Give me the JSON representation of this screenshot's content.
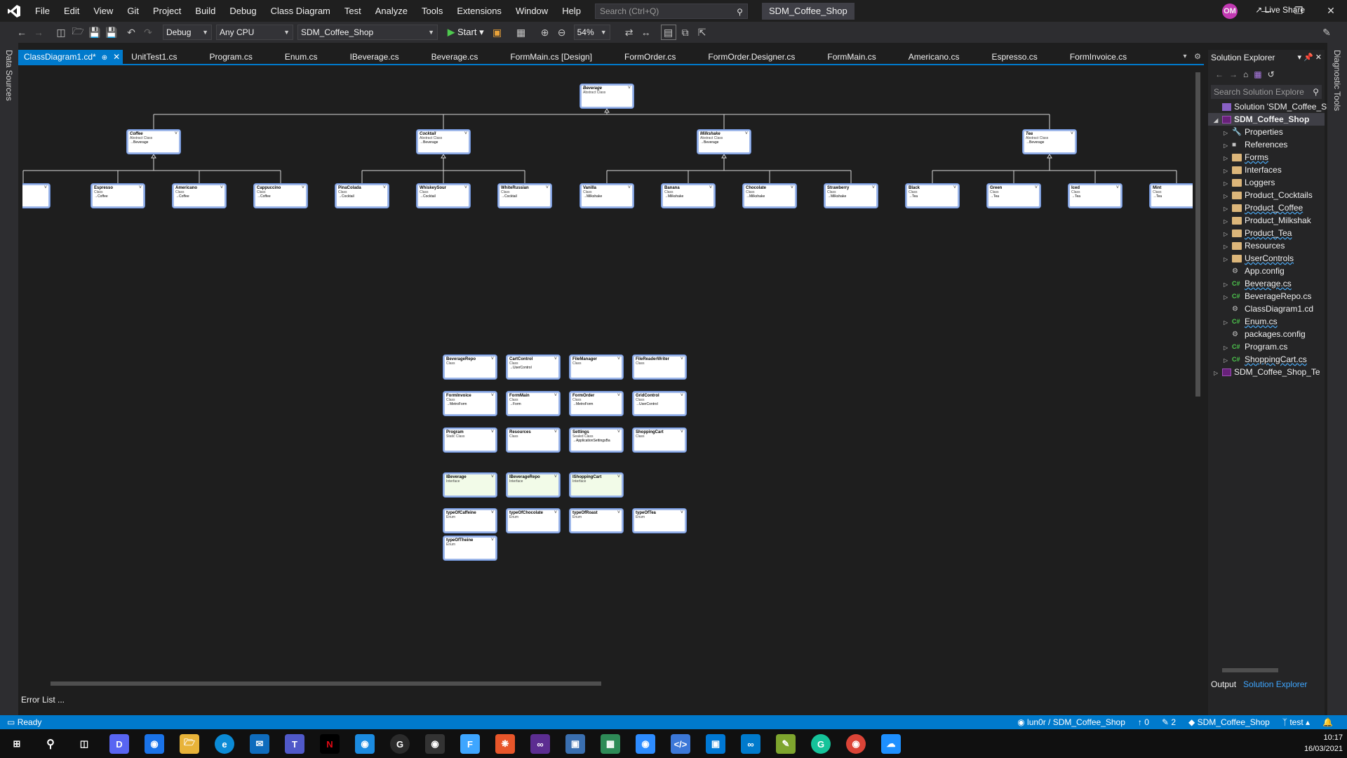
{
  "menubar": {
    "items": [
      "File",
      "Edit",
      "View",
      "Git",
      "Project",
      "Build",
      "Debug",
      "Class Diagram",
      "Test",
      "Analyze",
      "Tools",
      "Extensions",
      "Window",
      "Help"
    ],
    "search_placeholder": "Search (Ctrl+Q)",
    "title": "SDM_Coffee_Shop",
    "avatar": "OM"
  },
  "toolbar": {
    "config": "Debug",
    "platform": "Any CPU",
    "project": "SDM_Coffee_Shop",
    "start": "Start",
    "zoom": "54%",
    "liveshare": "Live Share"
  },
  "left_strip": "Data Sources",
  "right_strip": "Diagnostic Tools",
  "tabs": [
    "ClassDiagram1.cd*",
    "UnitTest1.cs",
    "Program.cs",
    "Enum.cs",
    "IBeverage.cs",
    "Beverage.cs",
    "FormMain.cs [Design]",
    "FormOrder.cs",
    "FormOrder.Designer.cs",
    "FormMain.cs",
    "Americano.cs",
    "Espresso.cs",
    "FormInvoice.cs"
  ],
  "diagram": {
    "root": {
      "name": "Beverage",
      "kind": "Abstract Class"
    },
    "abstracts": [
      {
        "name": "Coffee",
        "kind": "Abstract Class",
        "base": "Beverage"
      },
      {
        "name": "Cocktail",
        "kind": "Abstract Class",
        "base": "Beverage"
      },
      {
        "name": "Milkshake",
        "kind": "Abstract Class",
        "base": "Beverage"
      },
      {
        "name": "Tea",
        "kind": "Abstract Class",
        "base": "Beverage"
      }
    ],
    "leaves": [
      {
        "name": "",
        "kind": "",
        "base": "fee"
      },
      {
        "name": "Espresso",
        "kind": "Class",
        "base": "Coffee"
      },
      {
        "name": "Americano",
        "kind": "Class",
        "base": "Coffee"
      },
      {
        "name": "Cappuccino",
        "kind": "Class",
        "base": "Coffee"
      },
      {
        "name": "PinaColada",
        "kind": "Class",
        "base": "Cocktail"
      },
      {
        "name": "WhiskeySour",
        "kind": "Class",
        "base": "Cocktail"
      },
      {
        "name": "WhiteRussian",
        "kind": "Class",
        "base": "Cocktail"
      },
      {
        "name": "Vanilla",
        "kind": "Class",
        "base": "Milkshake"
      },
      {
        "name": "Banana",
        "kind": "Class",
        "base": "Milkshake"
      },
      {
        "name": "Chocolate",
        "kind": "Class",
        "base": "Milkshake"
      },
      {
        "name": "Strawberry",
        "kind": "Class",
        "base": "Milkshake"
      },
      {
        "name": "Black",
        "kind": "Class",
        "base": "Tea"
      },
      {
        "name": "Green",
        "kind": "Class",
        "base": "Tea"
      },
      {
        "name": "Iced",
        "kind": "Class",
        "base": "Tea"
      },
      {
        "name": "Mint",
        "kind": "Class",
        "base": "Tea"
      }
    ],
    "grid": [
      {
        "name": "BeverageRepo",
        "kind": "Class",
        "base": ""
      },
      {
        "name": "CartControl",
        "kind": "Class",
        "base": "UserControl"
      },
      {
        "name": "FileManager",
        "kind": "Class",
        "base": ""
      },
      {
        "name": "FileReaderWriter",
        "kind": "Class",
        "base": ""
      },
      {
        "name": "FormInvoice",
        "kind": "Class",
        "base": "MetroForm"
      },
      {
        "name": "FormMain",
        "kind": "Class",
        "base": "Form"
      },
      {
        "name": "FormOrder",
        "kind": "Class",
        "base": "MetroForm"
      },
      {
        "name": "GridControl",
        "kind": "Class",
        "base": "UserControl"
      },
      {
        "name": "Program",
        "kind": "Static Class",
        "base": ""
      },
      {
        "name": "Resources",
        "kind": "Class",
        "base": ""
      },
      {
        "name": "Settings",
        "kind": "Sealed Class",
        "base": "ApplicationSettingsBa"
      },
      {
        "name": "ShoppingCart",
        "kind": "Class",
        "base": ""
      }
    ],
    "interfaces": [
      {
        "name": "IBeverage",
        "kind": "Interface"
      },
      {
        "name": "IBeverageRepo",
        "kind": "Interface"
      },
      {
        "name": "IShoppingCart",
        "kind": "Interface"
      }
    ],
    "enums": [
      {
        "name": "typeOfCaffeine",
        "kind": "Enum"
      },
      {
        "name": "typeOfChocolate",
        "kind": "Enum"
      },
      {
        "name": "typeOfRoast",
        "kind": "Enum"
      },
      {
        "name": "typeOfTea",
        "kind": "Enum"
      },
      {
        "name": "typeOfTheine",
        "kind": "Enum"
      }
    ]
  },
  "error_list": "Error List ...",
  "solution_explorer": {
    "title": "Solution Explorer",
    "search_placeholder": "Search Solution Explore",
    "items": [
      {
        "label": "Solution 'SDM_Coffee_Sh",
        "icon": "sln",
        "exp": "",
        "depth": 0
      },
      {
        "label": "SDM_Coffee_Shop",
        "icon": "proj",
        "exp": "down",
        "depth": 0,
        "bold": true
      },
      {
        "label": "Properties",
        "icon": "wrench",
        "exp": "right",
        "depth": 1
      },
      {
        "label": "References",
        "icon": "ref",
        "exp": "right",
        "depth": 1
      },
      {
        "label": "Forms",
        "icon": "folder",
        "exp": "right",
        "depth": 1,
        "squiggle": true
      },
      {
        "label": "Interfaces",
        "icon": "folder",
        "exp": "right",
        "depth": 1
      },
      {
        "label": "Loggers",
        "icon": "folder",
        "exp": "right",
        "depth": 1
      },
      {
        "label": "Product_Cocktails",
        "icon": "folder",
        "exp": "right",
        "depth": 1
      },
      {
        "label": "Product_Coffee",
        "icon": "folder",
        "exp": "right",
        "depth": 1,
        "squiggle": true
      },
      {
        "label": "Product_Milkshak",
        "icon": "folder",
        "exp": "right",
        "depth": 1
      },
      {
        "label": "Product_Tea",
        "icon": "folder",
        "exp": "right",
        "depth": 1,
        "squiggle": true
      },
      {
        "label": "Resources",
        "icon": "folder",
        "exp": "right",
        "depth": 1
      },
      {
        "label": "UserControls",
        "icon": "folder",
        "exp": "right",
        "depth": 1,
        "squiggle": true
      },
      {
        "label": "App.config",
        "icon": "cfg",
        "exp": "",
        "depth": 1
      },
      {
        "label": "Beverage.cs",
        "icon": "cs",
        "exp": "right",
        "depth": 1,
        "squiggle": true
      },
      {
        "label": "BeverageRepo.cs",
        "icon": "cs",
        "exp": "right",
        "depth": 1
      },
      {
        "label": "ClassDiagram1.cd",
        "icon": "cfg",
        "exp": "",
        "depth": 1
      },
      {
        "label": "Enum.cs",
        "icon": "cs",
        "exp": "right",
        "depth": 1,
        "squiggle": true
      },
      {
        "label": "packages.config",
        "icon": "cfg",
        "exp": "",
        "depth": 1
      },
      {
        "label": "Program.cs",
        "icon": "cs",
        "exp": "right",
        "depth": 1
      },
      {
        "label": "ShoppingCart.cs",
        "icon": "cs",
        "exp": "right",
        "depth": 1,
        "squiggle": true
      },
      {
        "label": "SDM_Coffee_Shop_Te",
        "icon": "proj",
        "exp": "right",
        "depth": 0
      }
    ],
    "tab_output": "Output",
    "tab_solution": "Solution Explorer"
  },
  "statusbar": {
    "ready": "Ready",
    "repo": "lun0r / SDM_Coffee_Shop",
    "pushes": "0",
    "changes": "2",
    "project": "SDM_Coffee_Shop",
    "branch": "test"
  },
  "taskbar": {
    "time": "10:17",
    "date": "16/03/2021"
  },
  "colors": {
    "accent": "#007acc",
    "background": "#1e1e1e",
    "class_border": "#6b8fd6"
  }
}
